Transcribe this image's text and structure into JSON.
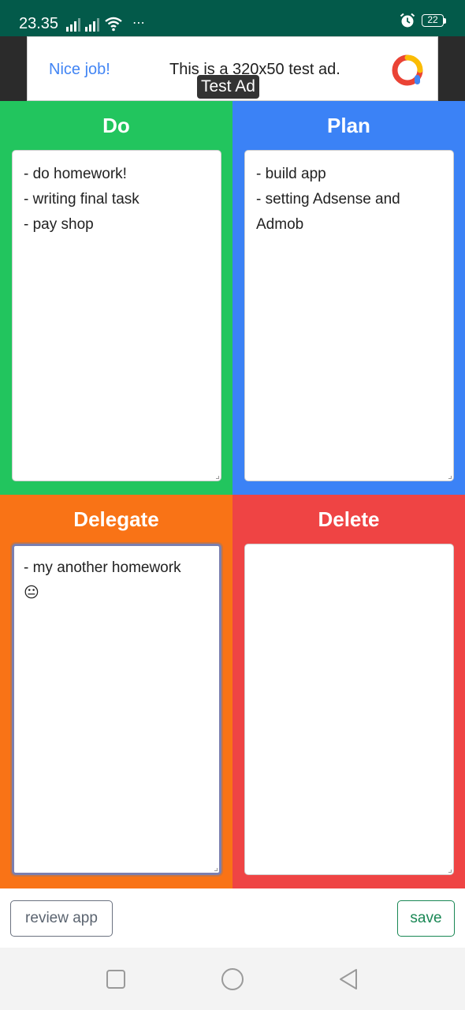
{
  "status_bar": {
    "time": "23.35",
    "battery": "22",
    "more": "⋯",
    "icons": [
      "signal-icon",
      "signal-icon",
      "wifi-icon",
      "alarm-icon",
      "battery-icon"
    ]
  },
  "ad": {
    "label": "Test Ad",
    "headline": "Nice job!",
    "body": "This is a 320x50 test ad.",
    "icon": "ad-logo-icon"
  },
  "quadrants": [
    {
      "title": "Do",
      "color": "#22c55e",
      "lines": [
        "- do homework!",
        "- writing final task",
        "- pay shop"
      ]
    },
    {
      "title": "Plan",
      "color": "#3b82f6",
      "lines": [
        "- build app",
        "- setting Adsense and Admob"
      ]
    },
    {
      "title": "Delegate",
      "color": "#f97316",
      "lines": [
        "- my another homework",
        "😐"
      ]
    },
    {
      "title": "Delete",
      "color": "#ef4444",
      "lines": []
    }
  ],
  "buttons": {
    "review": "review app",
    "save": "save"
  },
  "nav": {
    "icons": [
      "recent-apps-icon",
      "home-icon",
      "back-icon"
    ]
  }
}
